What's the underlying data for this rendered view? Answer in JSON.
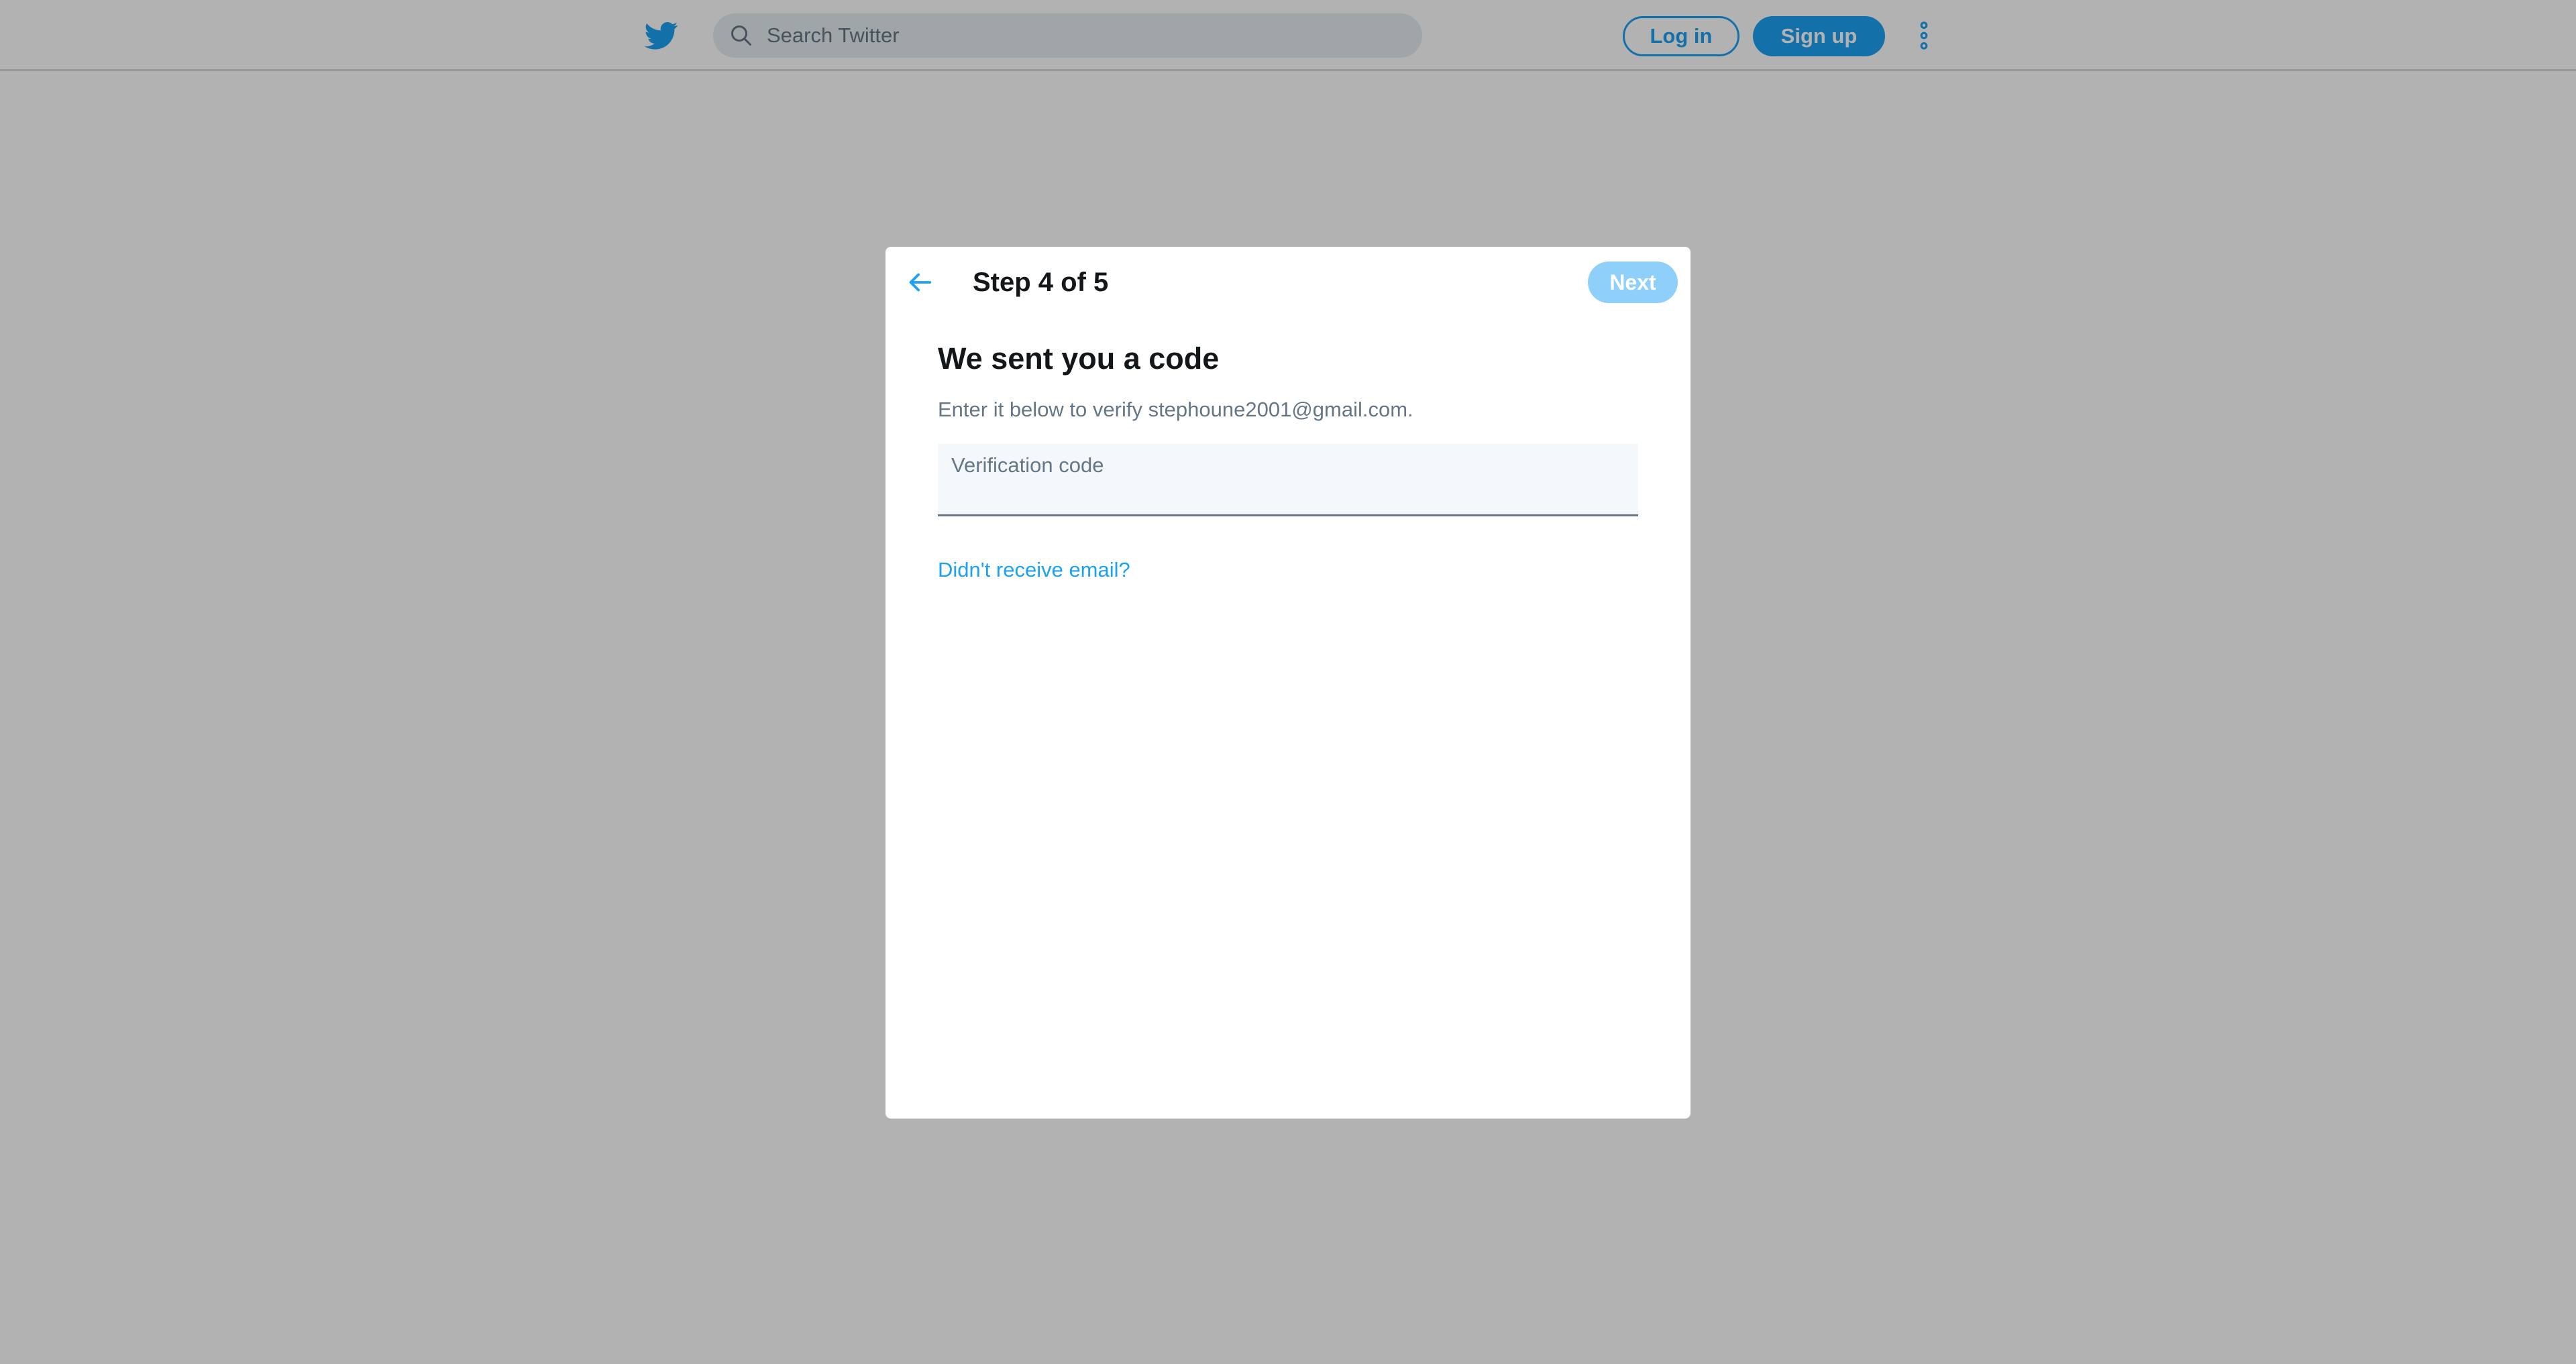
{
  "header": {
    "logo_icon": "twitter-bird-icon",
    "search": {
      "icon": "search-icon",
      "placeholder": "Search Twitter",
      "value": ""
    },
    "login_label": "Log in",
    "signup_label": "Sign up",
    "more_icon": "more-vertical-icon"
  },
  "modal": {
    "back_icon": "arrow-left-icon",
    "step_title": "Step 4 of 5",
    "next_label": "Next",
    "heading": "We sent you a code",
    "subtext": "Enter it below to verify stephoune2001@gmail.com.",
    "code_field": {
      "label": "Verification code",
      "value": ""
    },
    "resend_link": "Didn't receive email?"
  },
  "colors": {
    "brand": "#1da1f2",
    "brand_disabled": "#8ed0f9",
    "text_primary": "#14171a",
    "text_secondary": "#657786",
    "field_bg": "#f5f8fa",
    "overlay": "rgba(0,0,0,0.30)"
  }
}
